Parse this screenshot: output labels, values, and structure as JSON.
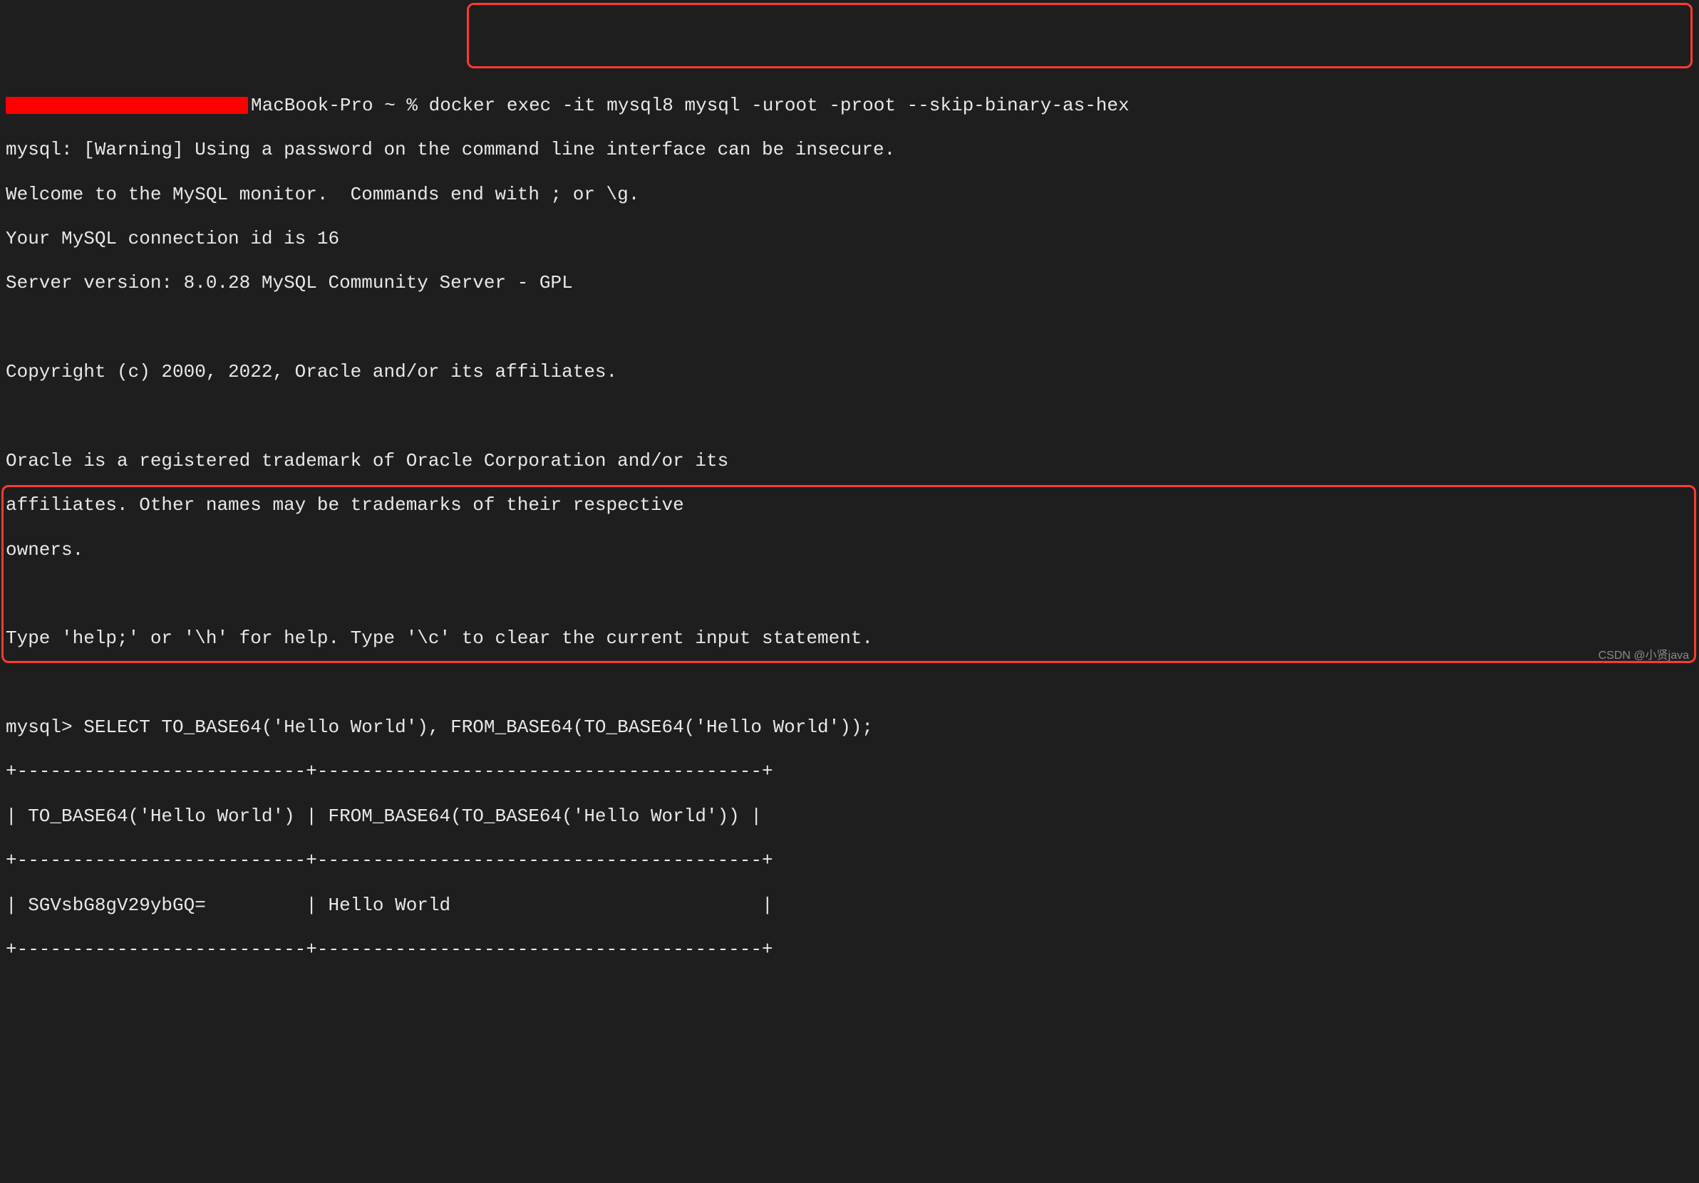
{
  "prompt": {
    "hostname_suffix": "MacBook-Pro ~ % ",
    "command": "docker exec -it mysql8 mysql -uroot -proot --skip-binary-as-hex"
  },
  "output": {
    "warning": "mysql: [Warning] Using a password on the command line interface can be insecure.",
    "welcome1": "Welcome to the MySQL monitor.  Commands end with ; or \\g.",
    "conn_id": "Your MySQL connection id is 16",
    "server_version": "Server version: 8.0.28 MySQL Community Server - GPL",
    "copyright": "Copyright (c) 2000, 2022, Oracle and/or its affiliates.",
    "trademark1": "Oracle is a registered trademark of Oracle Corporation and/or its",
    "trademark2": "affiliates. Other names may be trademarks of their respective",
    "trademark3": "owners.",
    "help_hint": "Type 'help;' or '\\h' for help. Type '\\c' to clear the current input statement."
  },
  "query": {
    "prompt": "mysql> ",
    "sql": "SELECT TO_BASE64('Hello World'), FROM_BASE64(TO_BASE64('Hello World'));"
  },
  "table": {
    "border": "+--------------------------+----------------------------------------+",
    "header": "| TO_BASE64('Hello World') | FROM_BASE64(TO_BASE64('Hello World')) |",
    "row": "| SGVsbG8gV29ybGQ=         | Hello World                            |"
  },
  "watermark": "CSDN @小贤java"
}
